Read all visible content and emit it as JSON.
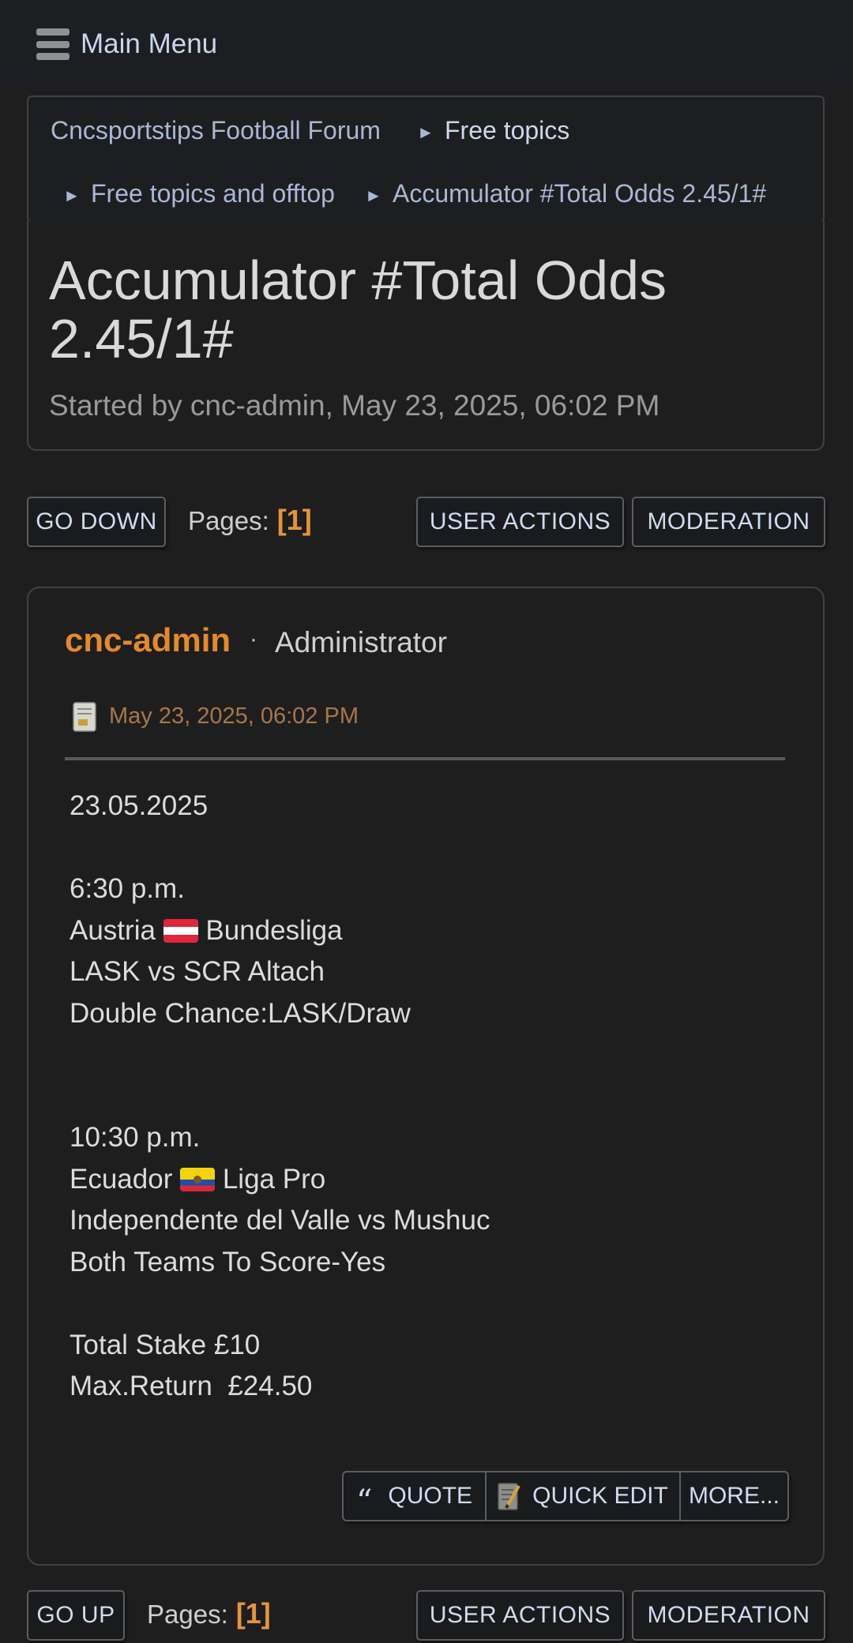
{
  "menu": {
    "label": "Main Menu",
    "icon": "hamburger-icon"
  },
  "breadcrumb": {
    "items": [
      "Cncsportstips Football Forum",
      "Free topics",
      "Free topics and offtop",
      "Accumulator #Total Odds 2.45/1#"
    ],
    "separator": "►"
  },
  "topic": {
    "title": "Accumulator #Total Odds 2.45/1#",
    "started": "Started by cnc-admin, May 23, 2025, 06:02 PM"
  },
  "nav_top": {
    "go_label": "GO DOWN",
    "pages_label": "Pages:",
    "pages_value": "[1]",
    "user_actions": "USER ACTIONS",
    "moderation": "MODERATION"
  },
  "post": {
    "author": "cnc-admin",
    "dot": "·",
    "role": "Administrator",
    "date": "May 23, 2025, 06:02 PM",
    "lines": {
      "date": "23.05.2025",
      "time1": "6:30 p.m.",
      "league1_country": "Austria",
      "league1_name": "Bundesliga",
      "match1": "LASK vs SCR Altach",
      "tip1": "Double Chance:LASK/Draw",
      "time2": "10:30 p.m.",
      "league2_country": "Ecuador",
      "league2_name": "Liga Pro",
      "match2": "Independente del Valle vs Mushuc",
      "tip2": "Both Teams To Score-Yes",
      "stake": "Total Stake £10",
      "return": "Max.Return  £24.50"
    },
    "actions": {
      "quote": "QUOTE",
      "quick_edit": "QUICK EDIT",
      "more": "MORE..."
    }
  },
  "nav_bottom": {
    "go_label": "GO UP",
    "pages_label": "Pages:",
    "pages_value": "[1]",
    "user_actions": "USER ACTIONS",
    "moderation": "MODERATION"
  },
  "colors": {
    "accent": "#e5892e",
    "link": "#a7b8d6",
    "background": "#1e1e1f"
  }
}
